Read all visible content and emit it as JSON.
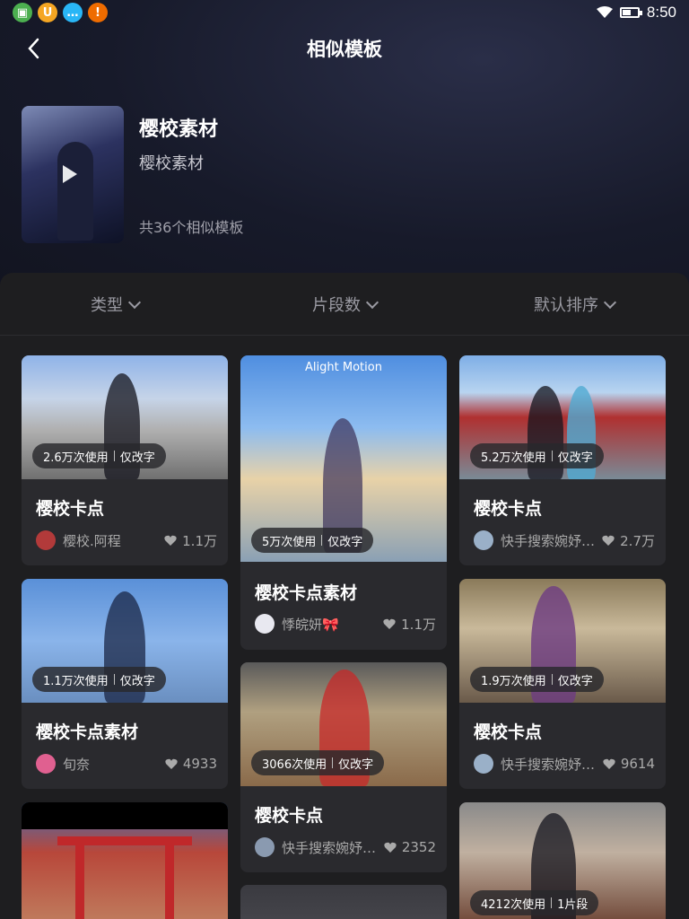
{
  "status_bar": {
    "time": "8:50",
    "app_icons": [
      "phone-app-icon",
      "u-app-icon",
      "chat-app-icon",
      "alert-app-icon"
    ],
    "app_glyphs": [
      "▣",
      "U",
      "…",
      "!"
    ],
    "app_colors": [
      "#4caf50",
      "#f5a623",
      "#29b6f6",
      "#ef6c00"
    ]
  },
  "nav": {
    "title": "相似模板"
  },
  "hero": {
    "title": "樱校素材",
    "subtitle": "樱校素材",
    "count": "共36个相似模板"
  },
  "filters": [
    {
      "label": "类型"
    },
    {
      "label": "片段数"
    },
    {
      "label": "默认排序"
    }
  ],
  "cards": [
    {
      "usage": "2.6万次使用",
      "tag": "仅改字",
      "title": "樱校卡点",
      "author": "樱校.阿程",
      "likes": "1.1万"
    },
    {
      "usage": "5万次使用",
      "tag": "仅改字",
      "title": "樱校卡点素材",
      "author": "悸皖妍🎀",
      "likes": "1.1万",
      "watermark": "Alight Motion"
    },
    {
      "usage": "5.2万次使用",
      "tag": "仅改字",
      "title": "樱校卡点",
      "author": "快手搜索婉妤…",
      "likes": "2.7万"
    },
    {
      "usage": "1.1万次使用",
      "tag": "仅改字",
      "title": "樱校卡点素材",
      "author": "旬奈",
      "likes": "4933"
    },
    {
      "usage": "3066次使用",
      "tag": "仅改字",
      "title": "樱校卡点",
      "author": "快手搜索婉妤…",
      "likes": "2352"
    },
    {
      "usage": "1.9万次使用",
      "tag": "仅改字",
      "title": "樱校卡点",
      "author": "快手搜索婉妤…",
      "likes": "9614"
    },
    {
      "usage": "4212次使用",
      "tag": "1片段"
    }
  ],
  "colors": {
    "background": "#1a1a1c",
    "card": "#2a2a2e",
    "muted": "#9a9aa2"
  }
}
